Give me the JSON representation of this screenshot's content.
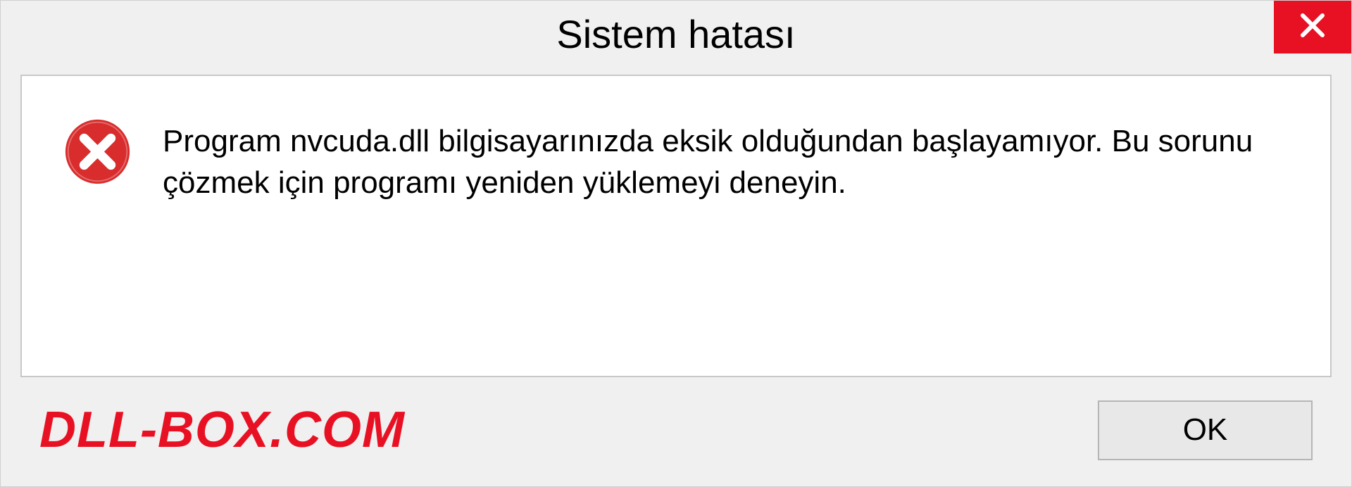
{
  "dialog": {
    "title": "Sistem hatası",
    "message": "Program nvcuda.dll bilgisayarınızda eksik olduğundan başlayamıyor. Bu sorunu çözmek için programı yeniden yüklemeyi deneyin.",
    "ok_button_label": "OK"
  },
  "watermark": {
    "text": "DLL-BOX.COM"
  },
  "colors": {
    "close_button_bg": "#e81123",
    "error_icon_bg": "#d92d2d",
    "watermark_color": "#e81123"
  }
}
